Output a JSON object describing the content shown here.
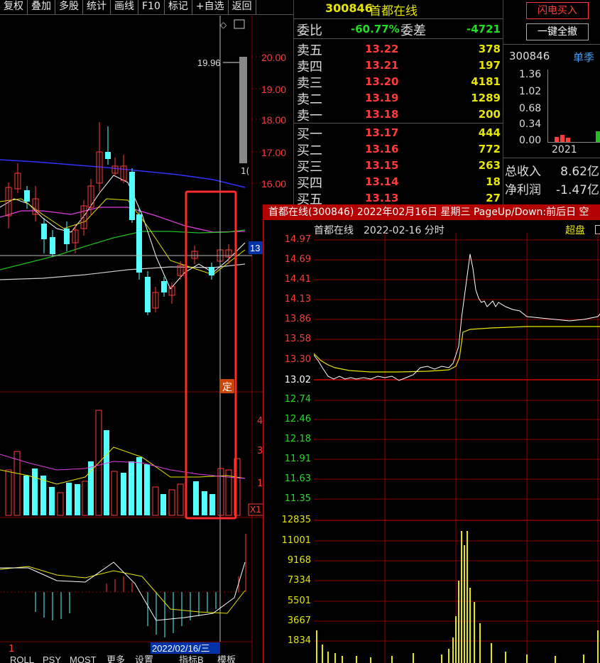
{
  "toolbar": {
    "items": [
      "复权",
      "叠加",
      "多股",
      "统计",
      "画线",
      "F10",
      "标记",
      "+自选",
      "返回"
    ]
  },
  "kchart": {
    "price_ticks": [
      "20.00",
      "19.00",
      "18.00",
      "17.00",
      "16.00"
    ],
    "price_current": "13",
    "high_label": "19.96",
    "right_cut_label": "1(",
    "vol_ticks": [
      "4",
      "3",
      "1"
    ],
    "vol_badge": "X1",
    "date_label": "2022/02/16/三",
    "cut_label": "1",
    "ding_label": "定",
    "bottom_tabs": [
      "ROLL",
      "PSY",
      "MOST",
      "更多",
      "设置",
      "指标B",
      "模板"
    ]
  },
  "orderbook": {
    "code": "300846",
    "name": "首都在线",
    "weibi_label": "委比",
    "weibi_value": "-60.77%",
    "weicha_label": "委差",
    "weicha_value": "-4721",
    "asks": [
      {
        "name": "卖五",
        "price": "13.22",
        "vol": "378"
      },
      {
        "name": "卖四",
        "price": "13.21",
        "vol": "197"
      },
      {
        "name": "卖三",
        "price": "13.20",
        "vol": "4181"
      },
      {
        "name": "卖二",
        "price": "13.19",
        "vol": "1289"
      },
      {
        "name": "卖一",
        "price": "13.18",
        "vol": "200"
      }
    ],
    "bids": [
      {
        "name": "买一",
        "price": "13.17",
        "vol": "444"
      },
      {
        "name": "买二",
        "price": "13.16",
        "vol": "772"
      },
      {
        "name": "买三",
        "price": "13.15",
        "vol": "263"
      },
      {
        "name": "买四",
        "price": "13.14",
        "vol": "18"
      },
      {
        "name": "买五",
        "price": "13.13",
        "vol": "27"
      }
    ]
  },
  "right_panel": {
    "flash_buy": "闪电买入",
    "cancel_all": "一键全撤",
    "code": "300846",
    "single_quarter": "单季",
    "yticks": [
      "1.36",
      "1.02",
      "0.68",
      "0.34",
      "0.00"
    ],
    "year": "2021",
    "metrics": [
      {
        "label": "总收入",
        "value": "8.62亿"
      },
      {
        "label": "净利润",
        "value": "-1.47亿"
      }
    ]
  },
  "popup": {
    "title": "首都在线(300846) 2022年02月16日 星期三 PageUp/Down:前后日 空",
    "subtitle_name": "首都在线",
    "subtitle_date": "2022-02-16 分时",
    "chaopan": "超盘",
    "price_ticks": [
      "14.97",
      "14.69",
      "14.41",
      "14.13",
      "13.86",
      "13.58",
      "13.30",
      "13.02",
      "12.74",
      "12.46",
      "12.18",
      "11.91",
      "11.63",
      "11.35"
    ],
    "vol_ticks": [
      "12835",
      "11001",
      "9168",
      "7334",
      "5501",
      "3667",
      "1834"
    ]
  },
  "colors": {
    "up": "#ff3b3b",
    "down": "#54ffff",
    "grid_red": "#8b0000",
    "yellow": "#e6e600",
    "highlight_box": "#ff2a2a"
  }
}
